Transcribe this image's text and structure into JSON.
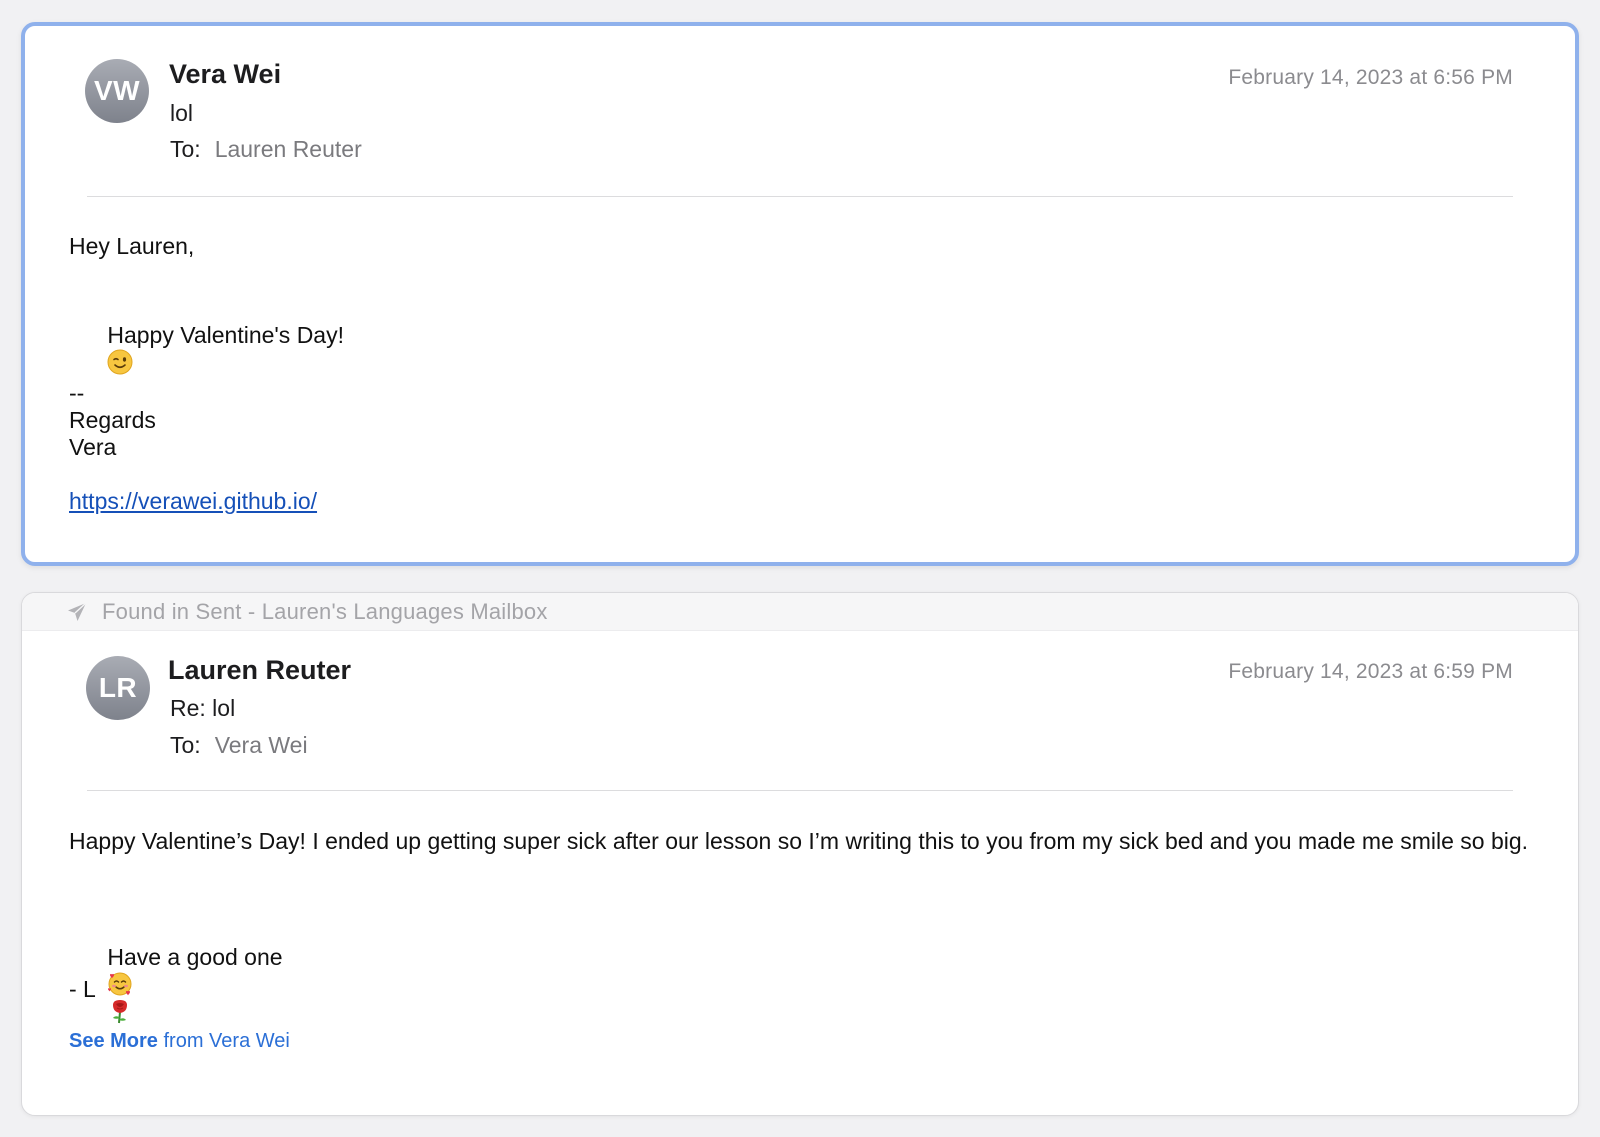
{
  "messages": [
    {
      "avatar_initials": "VW",
      "sender": "Vera Wei",
      "subject": "lol",
      "to_label": "To:",
      "to_name": "Lauren Reuter",
      "date": "February 14, 2023 at 6:56 PM",
      "body": {
        "greeting": "Hey Lauren,",
        "line1": "Happy Valentine's Day!",
        "line1_emoji": "winking-face-emoji",
        "sig_dashes": "--",
        "sig_regards": "Regards",
        "sig_name": "Vera",
        "link": "https://verawei.github.io/"
      },
      "selected": true
    },
    {
      "found_in": "Found in Sent - Lauren's Languages Mailbox",
      "found_icon": "paper-plane-icon",
      "avatar_initials": "LR",
      "sender": "Lauren Reuter",
      "subject": "Re: lol",
      "to_label": "To:",
      "to_name": "Vera Wei",
      "date": "February 14, 2023 at 6:59 PM",
      "body": {
        "paragraph1": "Happy Valentine’s Day! I ended up getting super sick after our lesson so I’m writing this to you from my sick bed and you made me smile so big.",
        "line2": "Have a good one",
        "line2_emojis": [
          "smiling-face-with-hearts-emoji",
          "rose-emoji"
        ],
        "closing": "- L"
      },
      "see_more_bold": "See More",
      "see_more_rest": "from Vera Wei"
    }
  ],
  "colors": {
    "selection_border": "#8fb1ec",
    "link": "#1550b8",
    "see_more": "#2b6fd6"
  }
}
